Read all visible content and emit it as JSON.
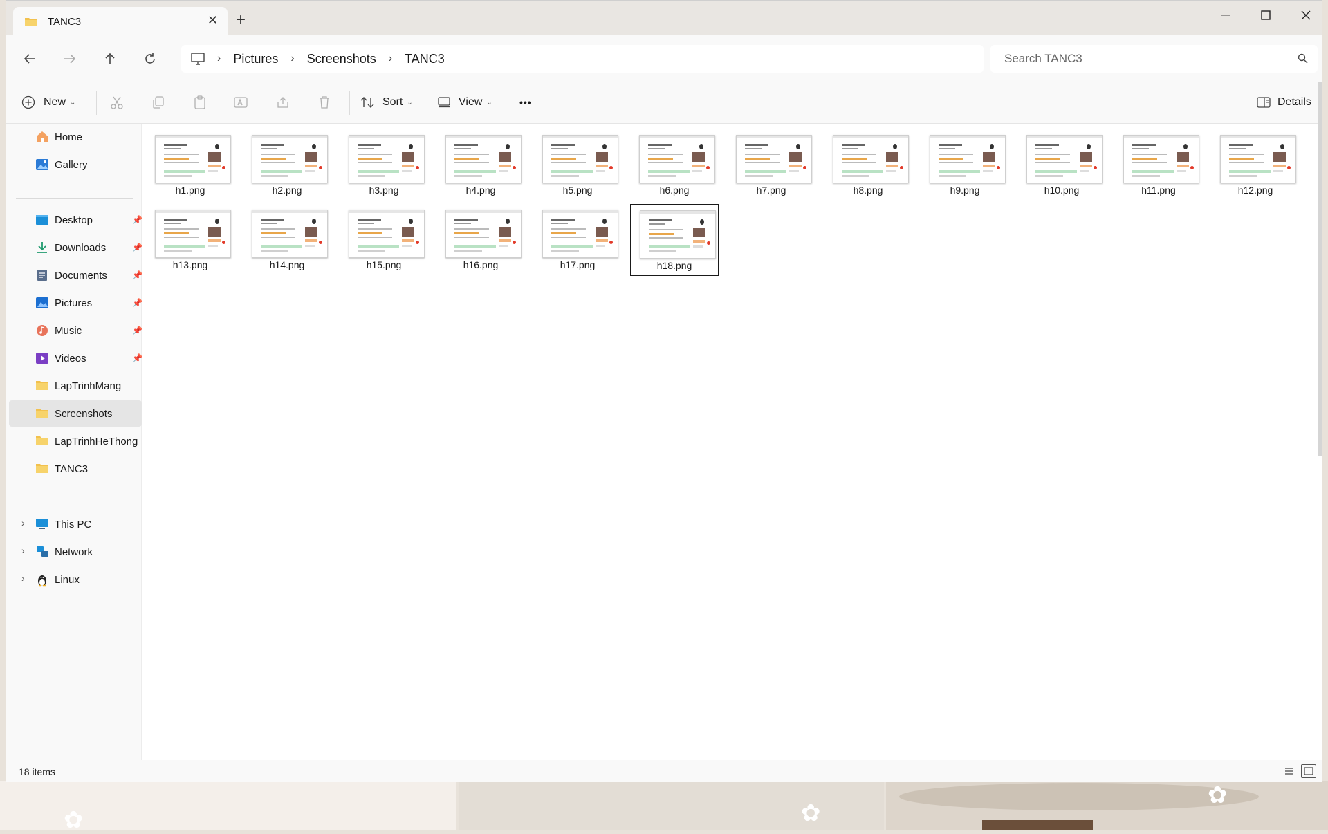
{
  "window": {
    "tab_title": "TANC3",
    "new_tab_symbol": "+",
    "close_symbol": "✕"
  },
  "nav": {
    "breadcrumbs": [
      "Pictures",
      "Screenshots",
      "TANC3"
    ],
    "search_placeholder": "Search TANC3"
  },
  "toolbar": {
    "new_label": "New",
    "sort_label": "Sort",
    "view_label": "View",
    "more_label": "•••",
    "details_label": "Details"
  },
  "sidebar": {
    "items": [
      {
        "label": "Home",
        "icon": "home-icon"
      },
      {
        "label": "Gallery",
        "icon": "gallery-icon"
      },
      {
        "label": "Desktop",
        "icon": "desktop-icon",
        "pinned": true
      },
      {
        "label": "Downloads",
        "icon": "download-icon",
        "pinned": true
      },
      {
        "label": "Documents",
        "icon": "document-icon",
        "pinned": true
      },
      {
        "label": "Pictures",
        "icon": "pictures-icon",
        "pinned": true
      },
      {
        "label": "Music",
        "icon": "music-icon",
        "pinned": true
      },
      {
        "label": "Videos",
        "icon": "videos-icon",
        "pinned": true
      },
      {
        "label": "LapTrinhMang",
        "icon": "folder-icon"
      },
      {
        "label": "Screenshots",
        "icon": "folder-icon",
        "active": true
      },
      {
        "label": "LapTrinhHeThong",
        "icon": "folder-icon"
      },
      {
        "label": "TANC3",
        "icon": "folder-icon"
      },
      {
        "label": "This PC",
        "icon": "pc-icon",
        "expandable": true
      },
      {
        "label": "Network",
        "icon": "network-icon",
        "expandable": true
      },
      {
        "label": "Linux",
        "icon": "linux-icon",
        "expandable": true
      }
    ]
  },
  "files": [
    "h1.png",
    "h2.png",
    "h3.png",
    "h4.png",
    "h5.png",
    "h6.png",
    "h7.png",
    "h8.png",
    "h9.png",
    "h10.png",
    "h11.png",
    "h12.png",
    "h13.png",
    "h14.png",
    "h15.png",
    "h16.png",
    "h17.png",
    "h18.png"
  ],
  "selected_file": "h18.png",
  "status": {
    "item_count": "18 items"
  },
  "colors": {
    "folder": "#f2c14e",
    "selection_border": "#1a1a1a",
    "active_sidebar": "#e5e5e5"
  }
}
